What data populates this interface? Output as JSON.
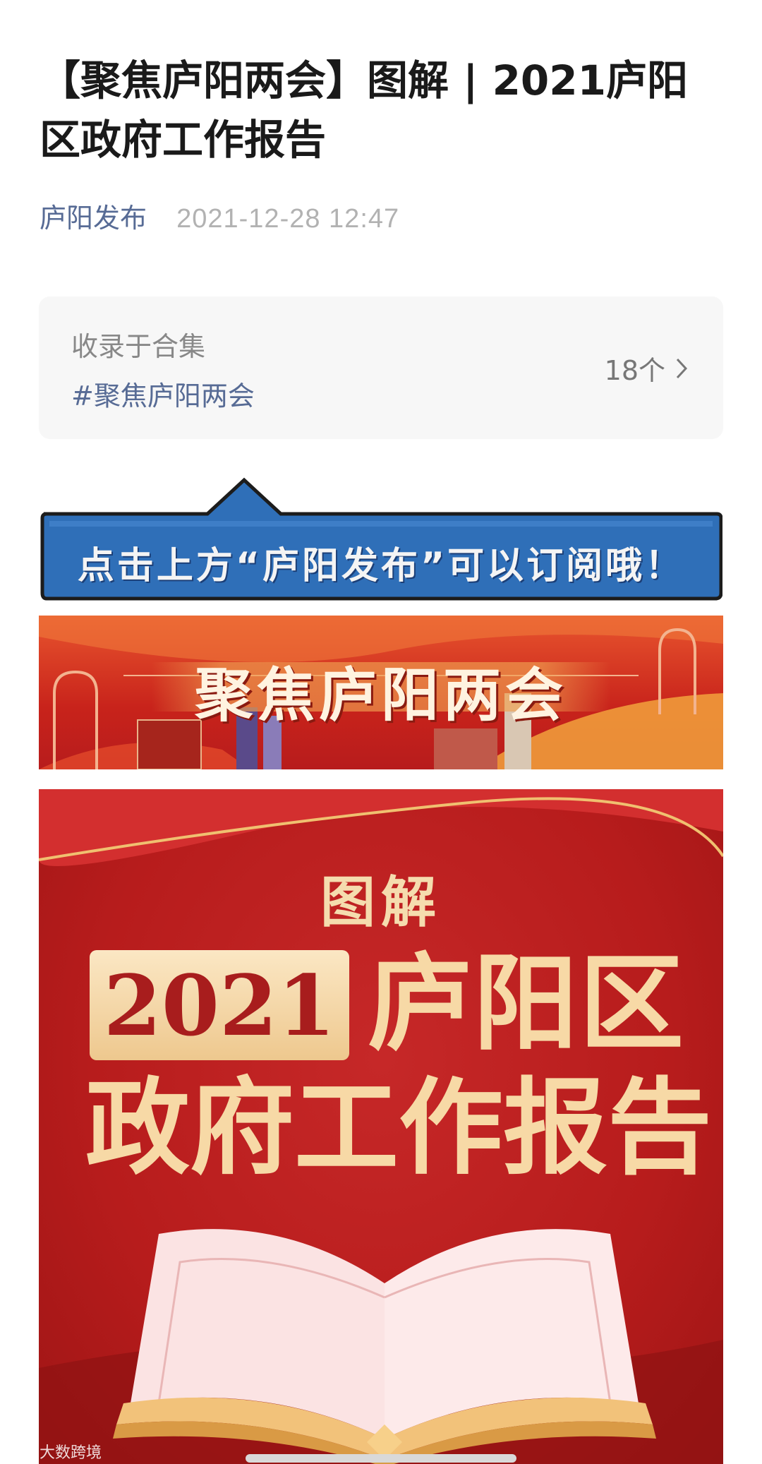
{
  "article": {
    "title": "【聚焦庐阳两会】图解 | 2021庐阳区政府工作报告",
    "author": "庐阳发布",
    "date": "2021-12-28 12:47"
  },
  "collection": {
    "label": "收录于合集",
    "tag": "#聚焦庐阳两会",
    "count": "18个"
  },
  "subscribe_banner": {
    "text": "点击上方“庐阳发布”可以订阅哦！"
  },
  "section_banner": {
    "text": "聚焦庐阳两会"
  },
  "poster": {
    "label": "图解",
    "year": "2021",
    "line1": "庐阳区",
    "line2": "政府工作报告"
  },
  "watermark": {
    "text": "大数跨境"
  },
  "colors": {
    "link": "#576b95",
    "meta_gray": "#b2b2b2",
    "card_bg": "#f7f7f7",
    "poster_red": "#b71c1c",
    "gold": "#f7d9a6",
    "subscribe_blue": "#2f6fb8"
  },
  "icons": {
    "collection_arrow": "chevron-right-icon",
    "book": "open-book-illustration"
  }
}
